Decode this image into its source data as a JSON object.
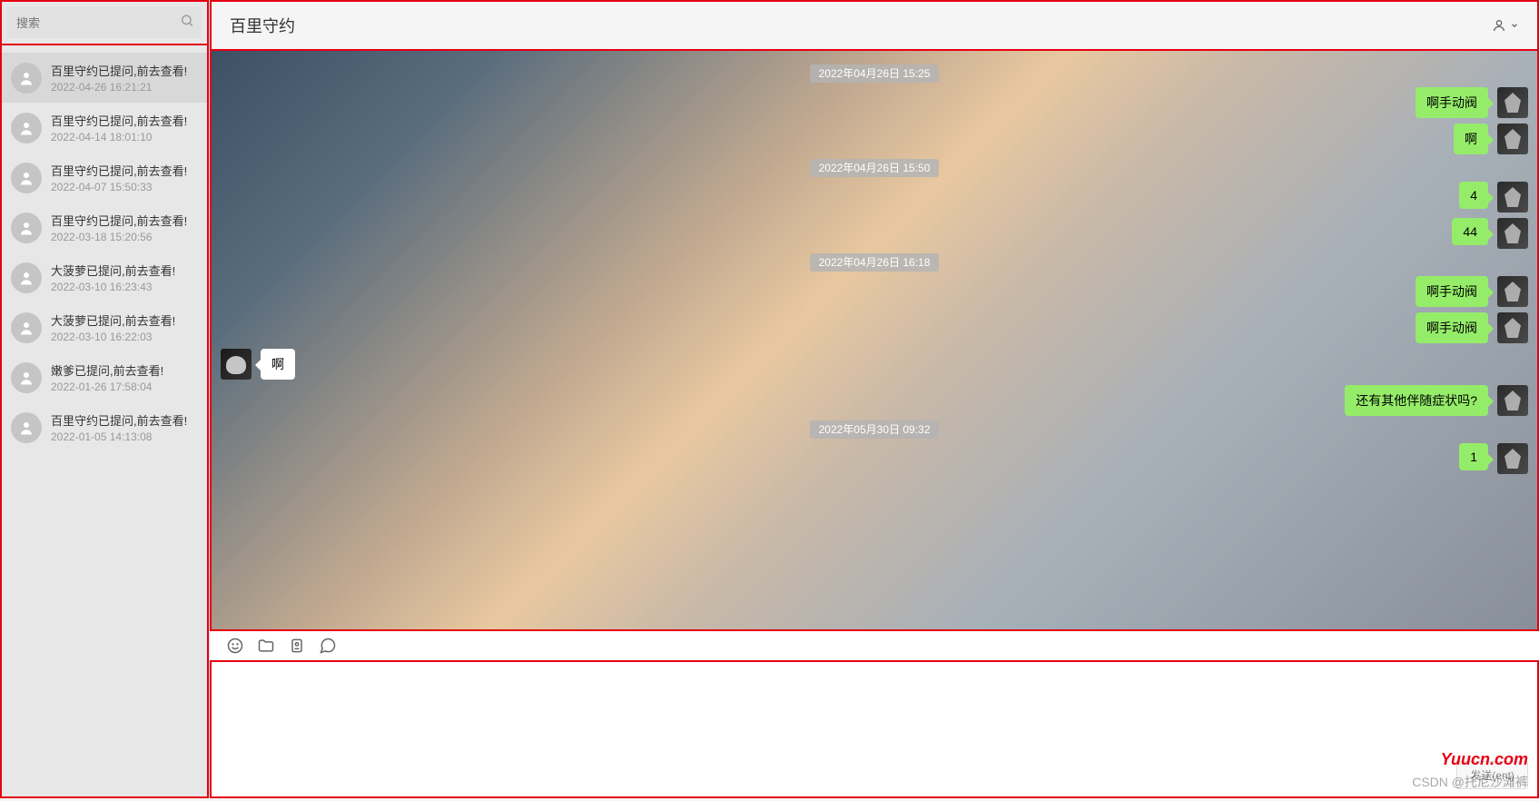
{
  "search": {
    "placeholder": "搜索"
  },
  "conversations": [
    {
      "title": "百里守约已提问,前去查看!",
      "time": "2022-04-26 16:21:21",
      "active": true
    },
    {
      "title": "百里守约已提问,前去查看!",
      "time": "2022-04-14 18:01:10",
      "active": false
    },
    {
      "title": "百里守约已提问,前去查看!",
      "time": "2022-04-07 15:50:33",
      "active": false
    },
    {
      "title": "百里守约已提问,前去查看!",
      "time": "2022-03-18 15:20:56",
      "active": false
    },
    {
      "title": "大菠萝已提问,前去查看!",
      "time": "2022-03-10 16:23:43",
      "active": false
    },
    {
      "title": "大菠萝已提问,前去查看!",
      "time": "2022-03-10 16:22:03",
      "active": false
    },
    {
      "title": "嫩爹已提问,前去查看!",
      "time": "2022-01-26 17:58:04",
      "active": false
    },
    {
      "title": "百里守约已提问,前去查看!",
      "time": "2022-01-05 14:13:08",
      "active": false
    }
  ],
  "chat": {
    "title": "百里守约",
    "timeline": [
      {
        "type": "time",
        "text": "2022年04月26日 15:25"
      },
      {
        "type": "msg",
        "side": "right",
        "text": "啊手动阀",
        "avatar": "av1"
      },
      {
        "type": "msg",
        "side": "right",
        "text": "啊",
        "avatar": "av1"
      },
      {
        "type": "time",
        "text": "2022年04月26日 15:50"
      },
      {
        "type": "msg",
        "side": "right",
        "text": "4",
        "avatar": "av1"
      },
      {
        "type": "msg",
        "side": "right",
        "text": "44",
        "avatar": "av1"
      },
      {
        "type": "time",
        "text": "2022年04月26日 16:18"
      },
      {
        "type": "msg",
        "side": "right",
        "text": "啊手动阀",
        "avatar": "av1"
      },
      {
        "type": "msg",
        "side": "right",
        "text": "啊手动阀",
        "avatar": "av1"
      },
      {
        "type": "msg",
        "side": "left",
        "text": "啊",
        "avatar": "av2"
      },
      {
        "type": "msg",
        "side": "right",
        "text": "还有其他伴随症状吗?",
        "avatar": "av1"
      },
      {
        "type": "time",
        "text": "2022年05月30日 09:32"
      },
      {
        "type": "msg",
        "side": "right",
        "text": "1",
        "avatar": "av1"
      }
    ]
  },
  "sendButton": "发送(ent)",
  "watermark": "Yuucn.com",
  "csdn": "CSDN @托尼沙滩裤"
}
